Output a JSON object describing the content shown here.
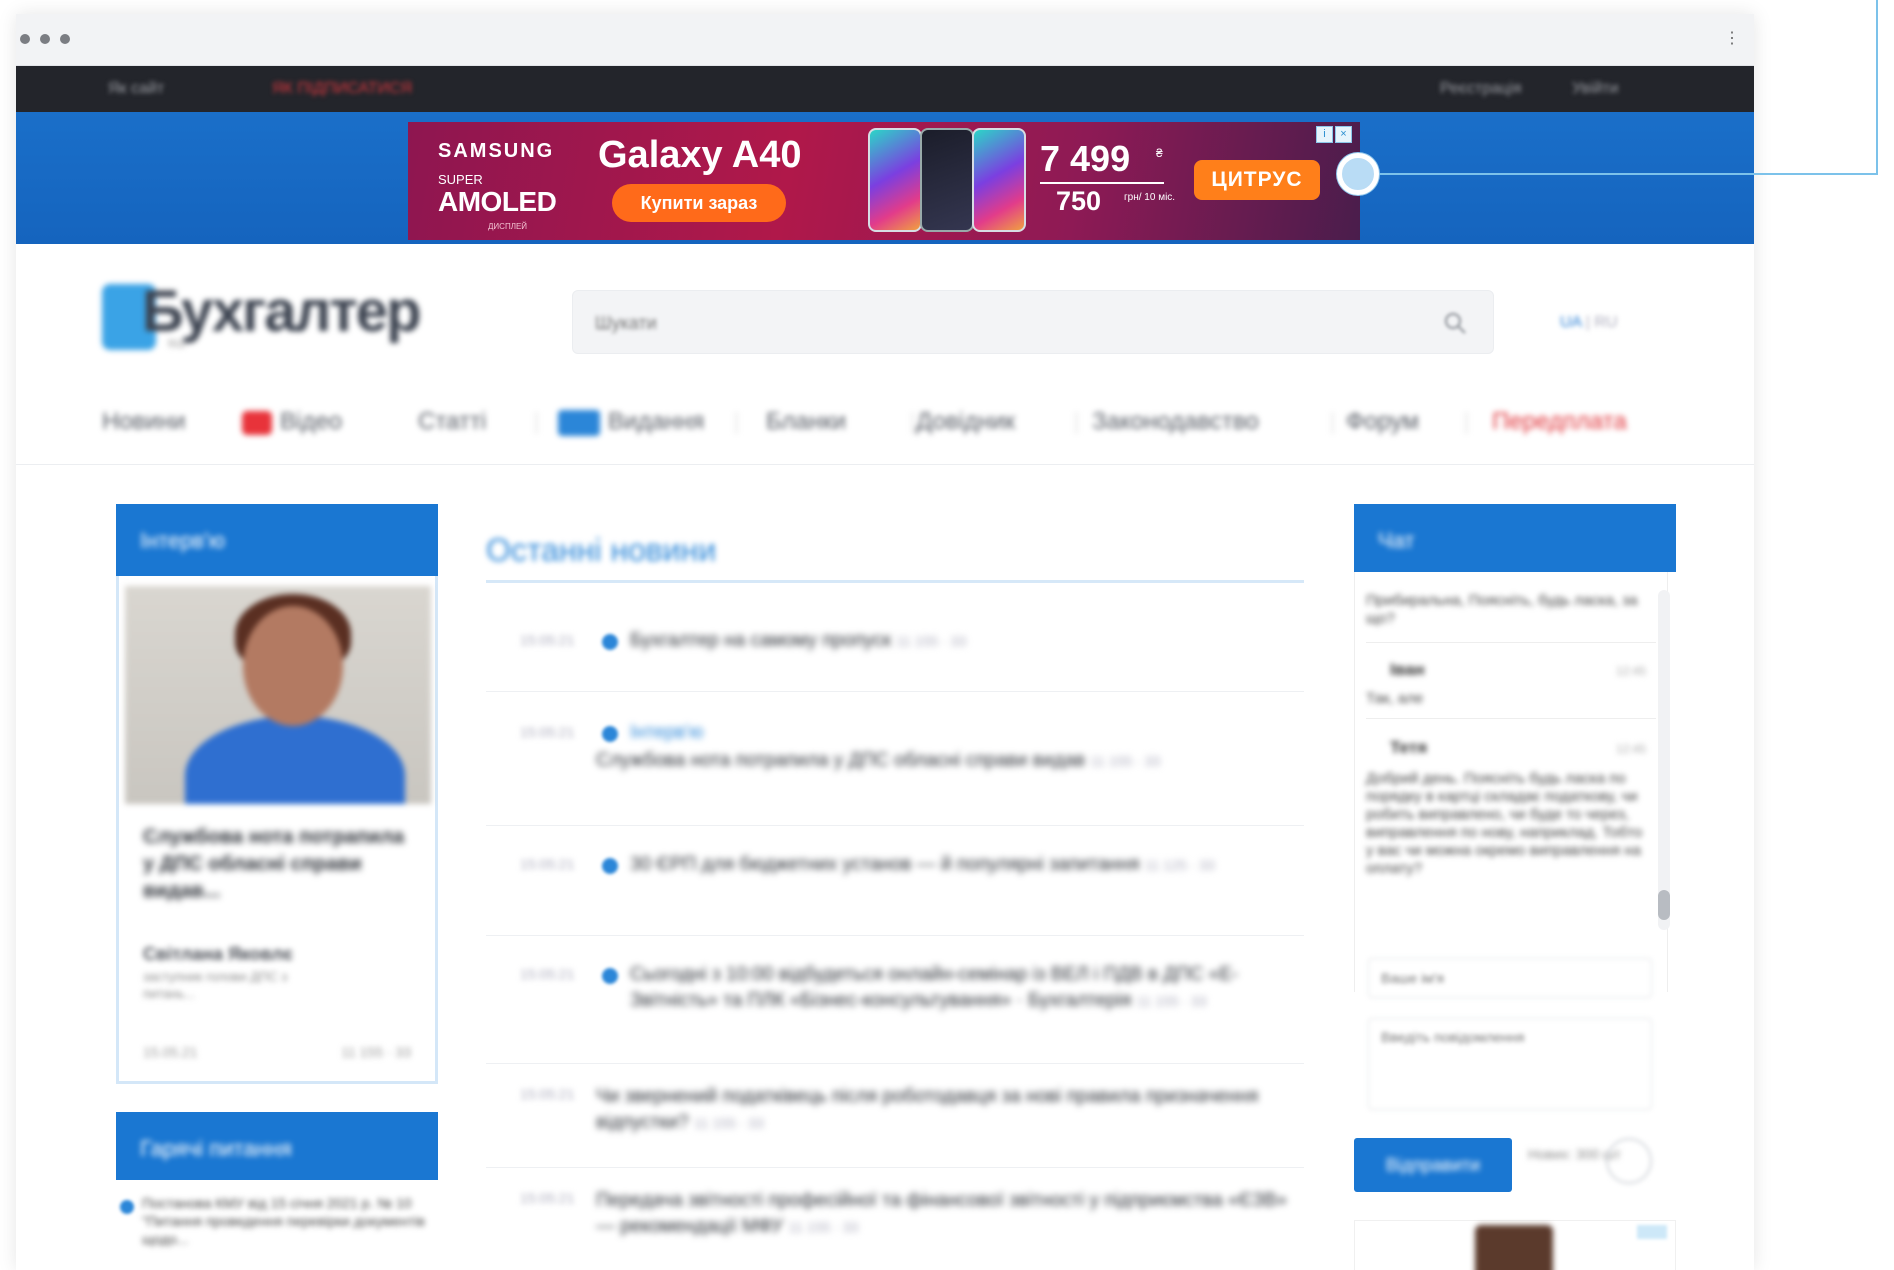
{
  "browser": {
    "menu_icon": "kebab-menu-icon"
  },
  "topbar": {
    "left_link": "Як сайт",
    "alert_link": "ЯК ПІДПИСАТИСЯ",
    "register": "Реєстрація",
    "login": "Увійти"
  },
  "ad": {
    "brand": "SAMSUNG",
    "super": "SUPER",
    "amoled": "AMOLED",
    "display": "ДИСПЛЕЙ",
    "model": "Galaxy A40",
    "buy_label": "Купити зараз",
    "price": "7 499",
    "price_unit": "₴",
    "monthly": "750",
    "monthly_unit": "грн/ 10 міс.",
    "store": "ЦИТРУС",
    "close_info": "i",
    "close_x": "×"
  },
  "header": {
    "logo_text": "Бухгалтер",
    "logo_sub": "911",
    "search_placeholder": "Шукати",
    "lang_active": "UA",
    "lang_sep": "|",
    "lang_other": "RU"
  },
  "nav": {
    "items": [
      "Новини",
      "Відео",
      "Статті",
      "Видання",
      "Бланки",
      "Довідник",
      "Законодавство",
      "Форум",
      "Передплата"
    ]
  },
  "interview": {
    "header": "Інтерв'ю",
    "title": "Службова нота потрапила у ДПС обласні справи видав...",
    "author": "Світлана Яковлє",
    "role": "заступник голови ДПС з питань...",
    "date": "15.05.21",
    "stats": "11 155 · 33"
  },
  "topics": {
    "header": "Гарячі питання",
    "text": "Постанова КМУ від 15 січня 2021 р. № 10 \"Питання проведення перевірки документів щодо..."
  },
  "news": {
    "title": "Останні новини",
    "items": [
      {
        "time": "15:05:21",
        "text": "Бухгалтер на самому пропуск",
        "meta": "11 155 · 33"
      },
      {
        "time": "15:05:21",
        "tag": "Інтерв'ю",
        "text": "Службова нота потрапила у ДПС обласні справи видав",
        "meta": "11 155 · 33"
      },
      {
        "time": "15:05:21",
        "text": "30 ЄРП для бюджетних установ — й популярні запитання",
        "meta": "11 125 · 33"
      },
      {
        "time": "15:05:21",
        "text": "Сьогодні з 10:00 відбудеться онлайн-семінар із ВЕЛ і ПДВ в ДПС «Е-Звітність» та ПЛК «Бізнес-консультування» · Бухгалтерія",
        "meta": "11 155 · 33"
      },
      {
        "time": "15:05:21",
        "text": "Чи звернений податківець після роботодавця за нові правила призначення відпустки?",
        "meta": "11 155 · 33"
      },
      {
        "time": "15:05:21",
        "text": "Передача звітності професійної та фінансової звітності у підприємства «ЄЗВ» — рекомендації МФУ",
        "meta": "11 155 · 33"
      }
    ]
  },
  "chat": {
    "header": "Чат",
    "messages": [
      {
        "name": "",
        "time": "",
        "text": "Прибиральна, Поясніть, будь ласка, за що?"
      },
      {
        "name": "Іван",
        "time": "12:45",
        "text": "Так, але"
      },
      {
        "name": "Тетя",
        "time": "12:45",
        "text": "Добрий день. Поясніть будь ласка по порядку в картці складає податкову, чи робить виправлено, чи буде то через, виправлення по нову, наприклад. Тобто у вас чи можна окремо виправлення на оплату?"
      }
    ],
    "name_placeholder": "Ваше ім'я",
    "message_placeholder": "Введіть повідомлення",
    "send_label": "Відправити",
    "counter": "Нових: 300 шт"
  }
}
